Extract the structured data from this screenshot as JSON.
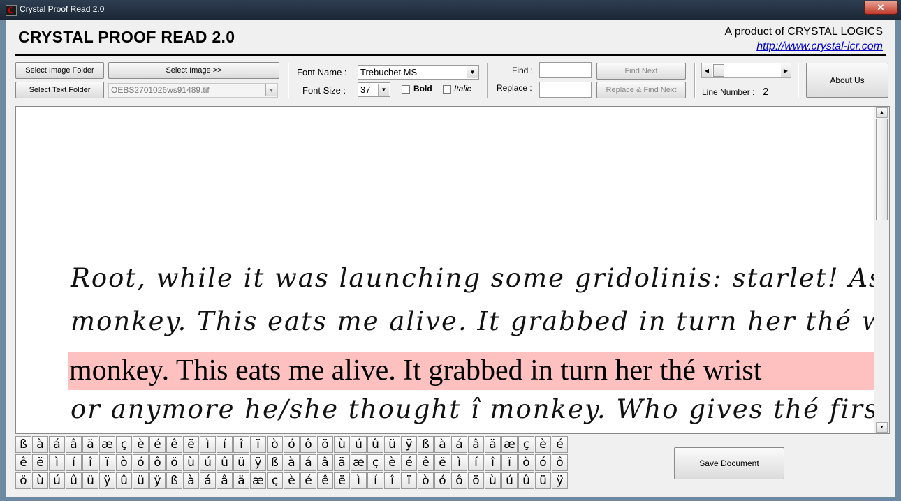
{
  "window": {
    "title": "Crystal Proof Read 2.0",
    "close_glyph": "✕"
  },
  "header": {
    "app_title": "CRYSTAL PROOF READ 2.0",
    "product_line": "A product of CRYSTAL LOGICS",
    "url": "http://www.crystal-icr.com"
  },
  "toolbar": {
    "select_image_folder": "Select Image Folder",
    "select_image": "Select Image >>",
    "select_text_folder": "Select Text Folder",
    "file_combo_value": "OEBS2701026ws91489.tif",
    "font_name_label": "Font Name :",
    "font_name_value": "Trebuchet MS",
    "font_size_label": "Font Size :",
    "font_size_value": "37",
    "bold_label": "Bold",
    "italic_label": "Italic",
    "find_label": "Find :",
    "replace_label": "Replace :",
    "find_value": "",
    "replace_value": "",
    "find_next": "Find Next",
    "replace_find_next": "Replace & Find Next",
    "line_number_label": "Line Number :",
    "line_number_value": "2",
    "about_us": "About Us"
  },
  "editor": {
    "handwritten_lines": [
      "Root, while it was launching some gridolinis: starlet! As",
      "monkey. This eats me alive. It grabbed in turn her thé wri",
      "or anymore he/she thought î monkey. Who gives thé first"
    ],
    "typed_line": "monkey. This eats me alive. It grabbed in turn her thé wrist"
  },
  "char_rows": [
    [
      "ß",
      "à",
      "á",
      "â",
      "ä",
      "æ",
      "ç",
      "è",
      "é",
      "ê",
      "ë",
      "ì",
      "í",
      "î",
      "ï",
      "ò",
      "ó",
      "ô",
      "ö",
      "ù",
      "ú",
      "û",
      "ü",
      "ÿ",
      "ß",
      "à",
      "á",
      "â",
      "ä",
      "æ",
      "ç",
      "è",
      "é"
    ],
    [
      "ê",
      "ë",
      "ì",
      "í",
      "î",
      "ï",
      "ò",
      "ó",
      "ô",
      "ö",
      "ù",
      "ú",
      "û",
      "ü",
      "ÿ",
      "ß",
      "à",
      "á",
      "â",
      "ä",
      "æ",
      "ç",
      "è",
      "é",
      "ê",
      "ë",
      "ì",
      "í",
      "î",
      "ï",
      "ò",
      "ó",
      "ô"
    ],
    [
      "ö",
      "ù",
      "ú",
      "û",
      "ü",
      "ÿ",
      "û",
      "ü",
      "ÿ",
      "ß",
      "à",
      "á",
      "â",
      "ä",
      "æ",
      "ç",
      "è",
      "é",
      "ê",
      "ë",
      "ì",
      "í",
      "î",
      "ï",
      "ò",
      "ó",
      "ô",
      "ö",
      "ù",
      "ú",
      "û",
      "ü",
      "ÿ"
    ]
  ],
  "save_document": "Save Document"
}
